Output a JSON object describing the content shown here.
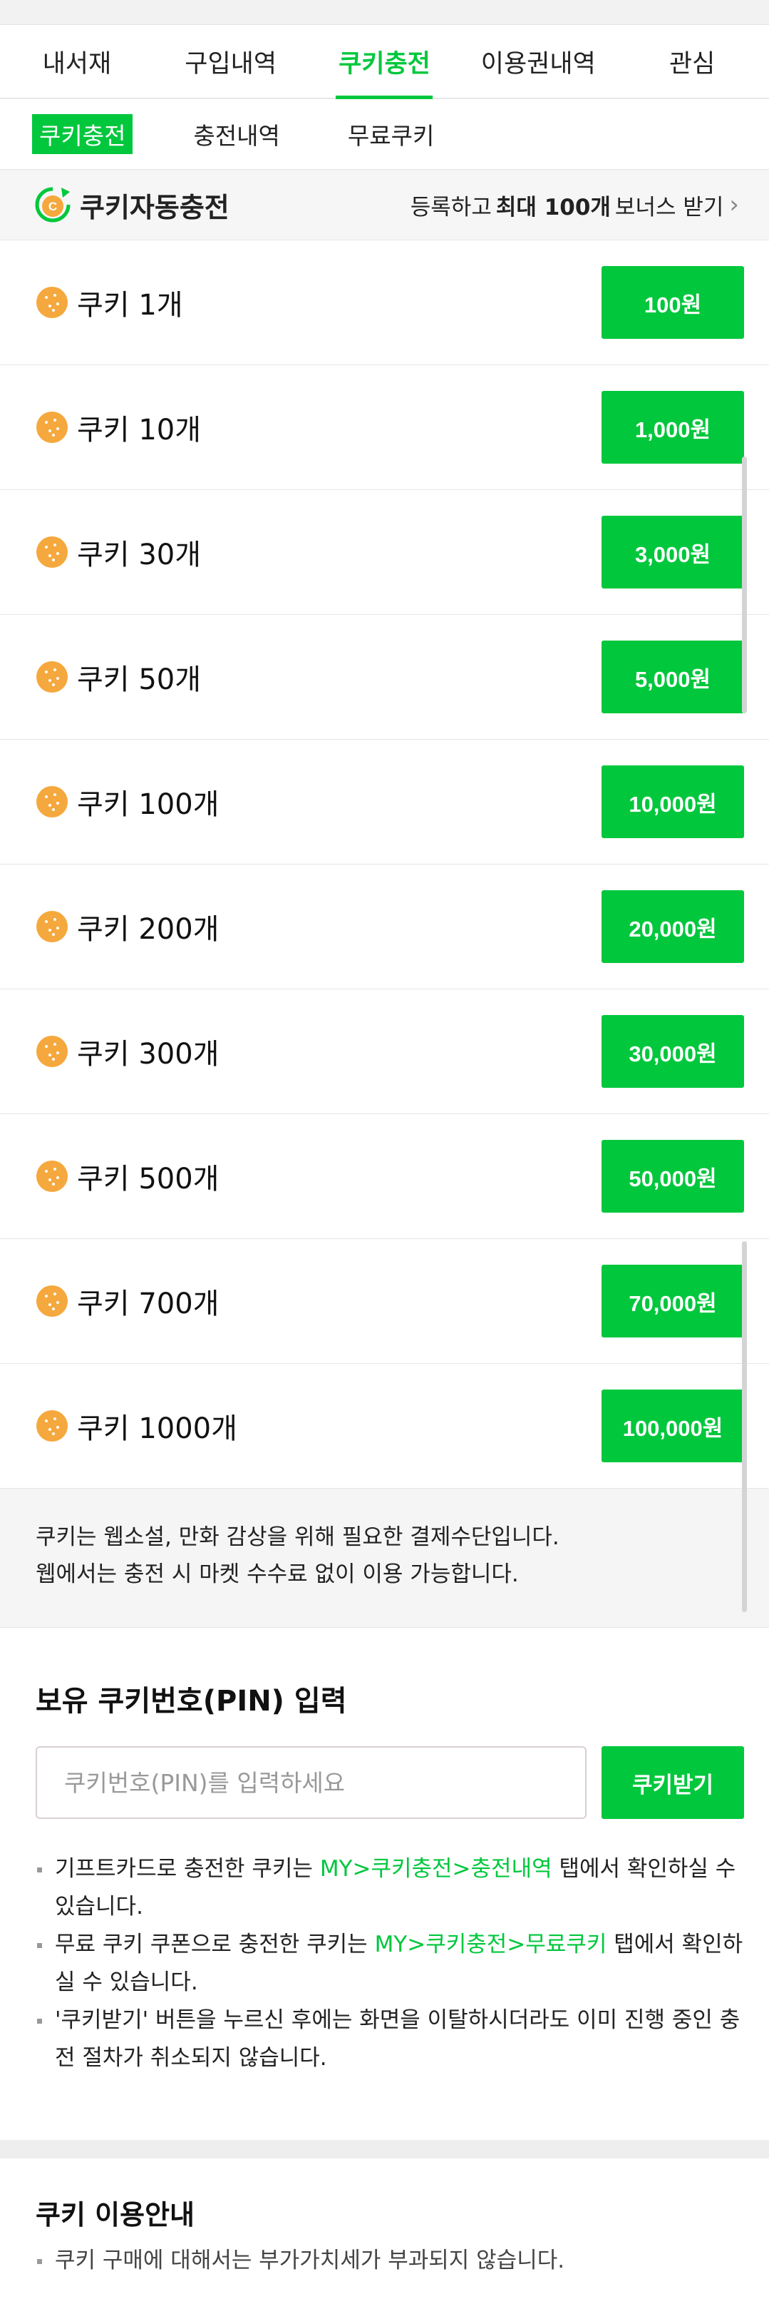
{
  "main_tabs": [
    "내서재",
    "구입내역",
    "쿠키충전",
    "이용권내역",
    "관심"
  ],
  "main_tab_active": "쿠키충전",
  "sub_tabs": [
    "쿠키충전",
    "충전내역",
    "무료쿠키"
  ],
  "sub_tab_active": "쿠키충전",
  "auto_charge": {
    "title": "쿠키자동충전",
    "promo_pre": "등록하고",
    "promo_bold": "최대 100개",
    "promo_post": "보너스 받기"
  },
  "packages": [
    {
      "label": "쿠키 1개",
      "price": "100원"
    },
    {
      "label": "쿠키 10개",
      "price": "1,000원"
    },
    {
      "label": "쿠키 30개",
      "price": "3,000원"
    },
    {
      "label": "쿠키 50개",
      "price": "5,000원"
    },
    {
      "label": "쿠키 100개",
      "price": "10,000원"
    },
    {
      "label": "쿠키 200개",
      "price": "20,000원"
    },
    {
      "label": "쿠키 300개",
      "price": "30,000원"
    },
    {
      "label": "쿠키 500개",
      "price": "50,000원"
    },
    {
      "label": "쿠키 700개",
      "price": "70,000원"
    },
    {
      "label": "쿠키 1000개",
      "price": "100,000원"
    }
  ],
  "notice": {
    "line1": "쿠키는 웹소설, 만화 감상을 위해 필요한 결제수단입니다.",
    "line2": "웹에서는 충전 시 마켓 수수료 없이 이용 가능합니다."
  },
  "pin": {
    "title": "보유 쿠키번호(PIN) 입력",
    "placeholder": "쿠키번호(PIN)를 입력하세요",
    "button": "쿠키받기",
    "note1_pre": "기프트카드로 충전한 쿠키는 ",
    "note1_link": "MY>쿠키충전>충전내역",
    "note1_post": " 탭에서 확인하실 수 있습니다.",
    "note2_pre": "무료 쿠키 쿠폰으로 충전한 쿠키는 ",
    "note2_link": "MY>쿠키충전>무료쿠키",
    "note2_post": " 탭에서 확인하실 수 있습니다.",
    "note3": "'쿠키받기' 버튼을 누르신 후에는 화면을 이탈하시더라도 이미 진행 중인 충전 절차가 취소되지 않습니다."
  },
  "guide": {
    "title": "쿠키 이용안내",
    "item1": "쿠키 구매에 대해서는 부가가치세가 부과되지 않습니다."
  },
  "colors": {
    "accent": "#00c73c",
    "cookie": "#f5a83d"
  },
  "icons": {
    "cookie": "cookie-icon",
    "auto_charge_logo": "cookie-auto-charge-logo-icon",
    "chevron": "chevron-right-icon"
  }
}
